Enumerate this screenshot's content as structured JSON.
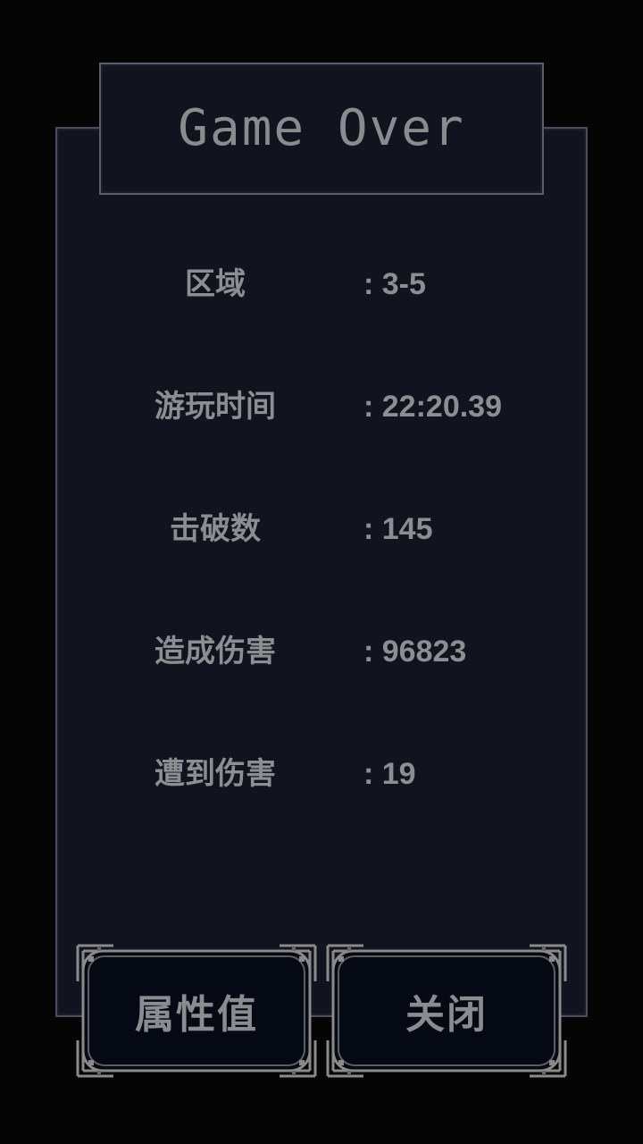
{
  "title": "Game Over",
  "stats": [
    {
      "label": "区域",
      "value": ": 3-5"
    },
    {
      "label": "游玩时间",
      "value": ": 22:20.39"
    },
    {
      "label": "击破数",
      "value": ": 145"
    },
    {
      "label": "造成伤害",
      "value": ": 96823"
    },
    {
      "label": "遭到伤害",
      "value": ": 19"
    }
  ],
  "buttons": {
    "attributes_label": "属性值",
    "close_label": "关闭"
  },
  "colors": {
    "background": "#050506",
    "panel": "#11131f",
    "border": "#4a4d5c",
    "text": "#8d8e91",
    "button_fill": "#050914",
    "ornament": "#8a8a8a"
  }
}
